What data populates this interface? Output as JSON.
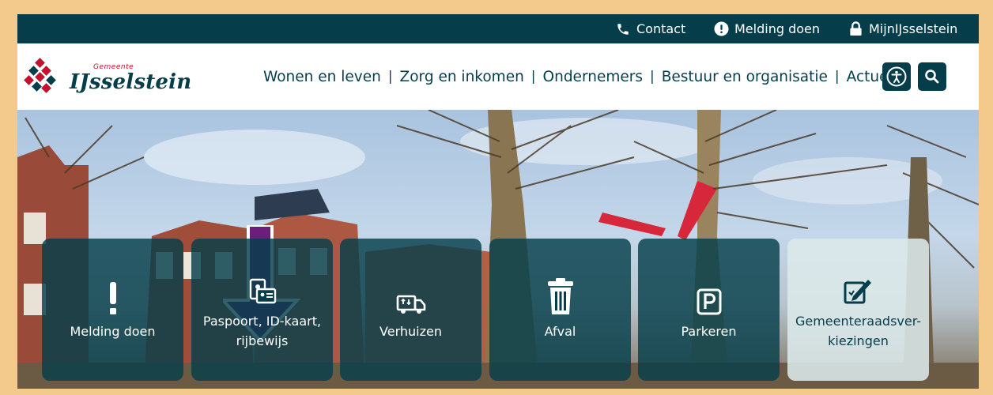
{
  "topbar": {
    "contact": "Contact",
    "melding": "Melding doen",
    "mijn": "MijnIJsselstein"
  },
  "logo": {
    "subtitle": "Gemeente",
    "name": "IJsselstein"
  },
  "nav": {
    "items": [
      "Wonen en leven",
      "Zorg en inkomen",
      "Ondernemers",
      "Bestuur en organisatie",
      "Actueel"
    ]
  },
  "header_icons": [
    "accessibility-icon",
    "search-icon"
  ],
  "tiles": [
    {
      "label": "Melding doen",
      "icon": "exclamation-icon"
    },
    {
      "label": "Paspoort, ID-kaart, rijbewijs",
      "icon": "id-card-icon"
    },
    {
      "label": "Verhuizen",
      "icon": "moving-truck-icon"
    },
    {
      "label": "Afval",
      "icon": "trash-icon"
    },
    {
      "label": "Parkeren",
      "icon": "parking-icon"
    },
    {
      "label": "Gemeenteraadsver-kiezingen",
      "icon": "ballot-pen-icon"
    }
  ],
  "colors": {
    "brand": "#053e4a",
    "accent_red": "#c8102e",
    "arrow": "#6b1f7a",
    "frame": "#f4c98c"
  }
}
